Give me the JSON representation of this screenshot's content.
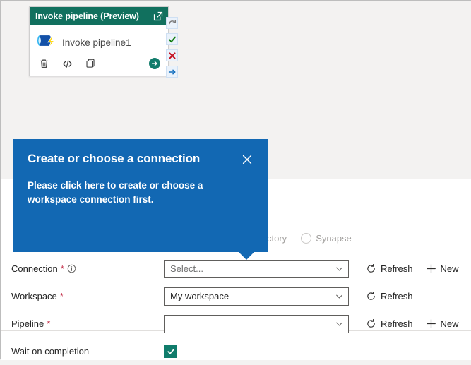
{
  "activity_card": {
    "header_title": "Invoke pipeline (Preview)",
    "popout_icon": "open-in-new-window-icon",
    "activity_icon": "invoke-pipeline-icon",
    "name": "Invoke pipeline1",
    "actions": [
      {
        "icon": "delete-icon",
        "name": "delete-activity-button"
      },
      {
        "icon": "code-icon",
        "name": "view-code-button"
      },
      {
        "icon": "copy-icon",
        "name": "copy-activity-button"
      }
    ],
    "run_button_icon": "run-arrow-icon"
  },
  "status_strip": [
    {
      "icon": "retry-icon",
      "name": "on-retry-output-handle",
      "color": "#7a7a7a"
    },
    {
      "icon": "check-icon",
      "name": "on-success-output-handle",
      "color": "#107c10"
    },
    {
      "icon": "cross-icon",
      "name": "on-fail-output-handle",
      "color": "#c50f1f"
    },
    {
      "icon": "arrow-right-icon",
      "name": "on-completion-output-handle",
      "color": "#0f6cbd"
    }
  ],
  "engine": {
    "options": [
      {
        "label": "a Factory",
        "selected": false
      },
      {
        "label": "Synapse",
        "selected": false
      }
    ]
  },
  "callout": {
    "title": "Create or choose a connection",
    "body": "Please click here to create or choose a workspace connection first.",
    "close_icon": "close-icon",
    "background": "#1268b3"
  },
  "form": {
    "rows": [
      {
        "label": "Connection",
        "required": "*",
        "has_info": true,
        "info_icon": "info-icon",
        "value": "",
        "placeholder": "Select...",
        "name": "connection-combobox",
        "actions": [
          {
            "label": "Refresh",
            "icon": "refresh-icon",
            "name": "refresh-connection-button"
          },
          {
            "label": "New",
            "icon": "plus-icon",
            "name": "new-connection-button"
          }
        ]
      },
      {
        "label": "Workspace",
        "required": "*",
        "has_info": false,
        "value": "My workspace",
        "placeholder": "",
        "name": "workspace-combobox",
        "actions": [
          {
            "label": "Refresh",
            "icon": "refresh-icon",
            "name": "refresh-workspace-button"
          }
        ]
      },
      {
        "label": "Pipeline",
        "required": "*",
        "has_info": false,
        "value": "",
        "placeholder": "",
        "name": "pipeline-combobox",
        "actions": [
          {
            "label": "Refresh",
            "icon": "refresh-icon",
            "name": "refresh-pipeline-button"
          },
          {
            "label": "New",
            "icon": "plus-icon",
            "name": "new-pipeline-button"
          }
        ]
      }
    ],
    "wait_on_completion": {
      "label": "Wait on completion",
      "checked": true,
      "check_icon": "checkmark-icon",
      "color": "#107c6b"
    }
  }
}
